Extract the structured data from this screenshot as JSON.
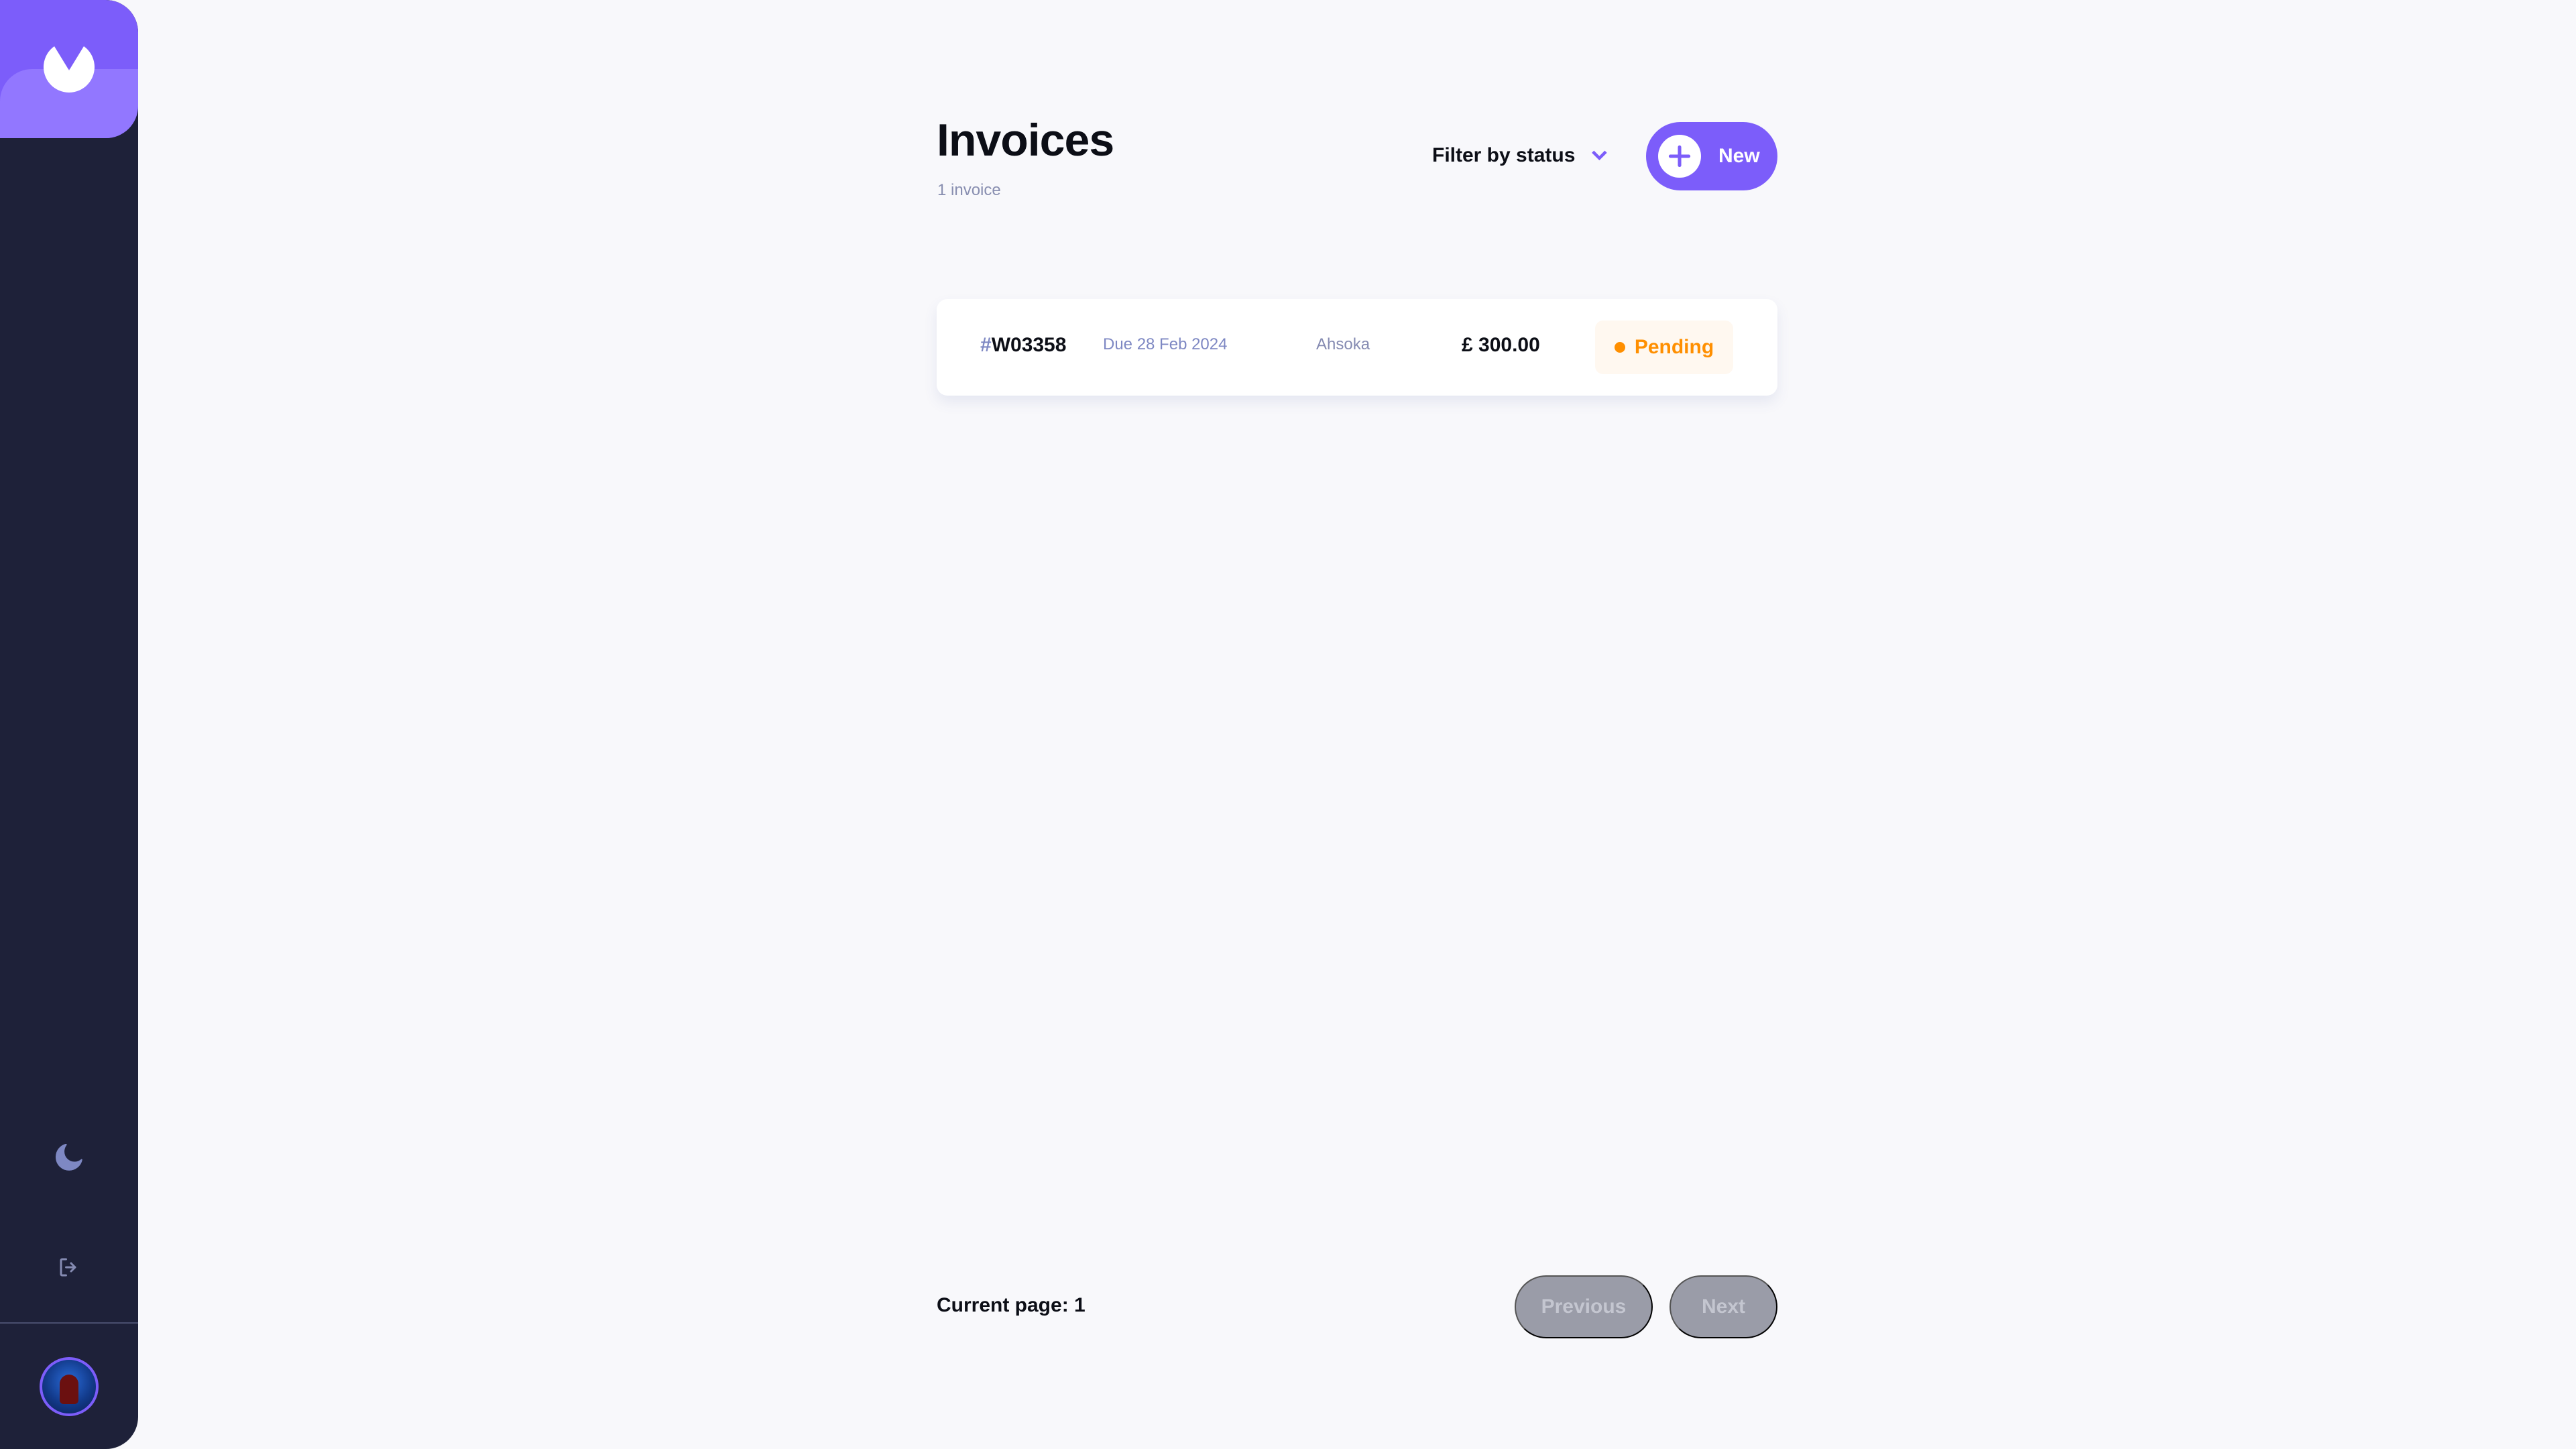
{
  "app": {
    "colors": {
      "sidebar": "#1E2139",
      "accent": "#7C5DFA",
      "accent_light": "#9277FF",
      "background": "#F8F8FB",
      "pending": "#FF8F00",
      "disabled_button": "#9A9CA8"
    }
  },
  "sidebar": {
    "logo_icon": "logo-icon",
    "theme_icon": "moon-icon",
    "logout_icon": "logout-icon",
    "avatar_icon": "avatar"
  },
  "header": {
    "title": "Invoices",
    "count": "1 invoice",
    "filter_label": "Filter by status",
    "new_button_label": "New"
  },
  "invoices": [
    {
      "hash": "#",
      "id": "W03358",
      "due": "Due 28 Feb 2024",
      "client": "Ahsoka",
      "amount": "£ 300.00",
      "status": "Pending"
    }
  ],
  "pagination": {
    "current_page_text": "Current page: 1",
    "previous_label": "Previous",
    "next_label": "Next"
  }
}
